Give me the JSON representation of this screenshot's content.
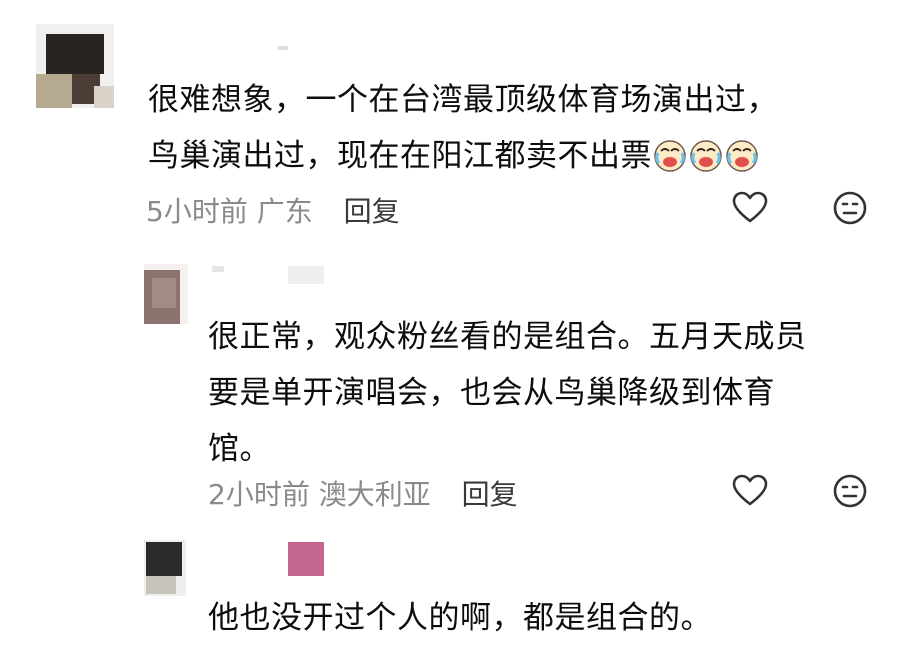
{
  "comments": [
    {
      "lines": [
        "很难想象，一个在台湾最顶级体育场演出过，",
        "鸟巢演出过，现在在阳江都卖不出票"
      ],
      "emoji_count": 3,
      "emoji_icon": "crying-laughing-emoji-icon",
      "time": "5小时前",
      "location": "广东",
      "reply_label": "回复"
    },
    {
      "lines": [
        "很正常，观众粉丝看的是组合。五月天成员",
        "要是单开演唱会，也会从鸟巢降级到体育",
        "馆。"
      ],
      "time": "2小时前",
      "location": "澳大利亚",
      "reply_label": "回复"
    },
    {
      "lines": [
        "他也没开过个人的啊，都是组合的。"
      ]
    }
  ],
  "icons": {
    "like": "heart-outline-icon",
    "emotion": "emoji-face-icon"
  },
  "colors": {
    "text": "#0d0d0d",
    "meta": "#8a8a8a",
    "reply": "#3a3a3a",
    "icon_stroke": "#333333"
  }
}
